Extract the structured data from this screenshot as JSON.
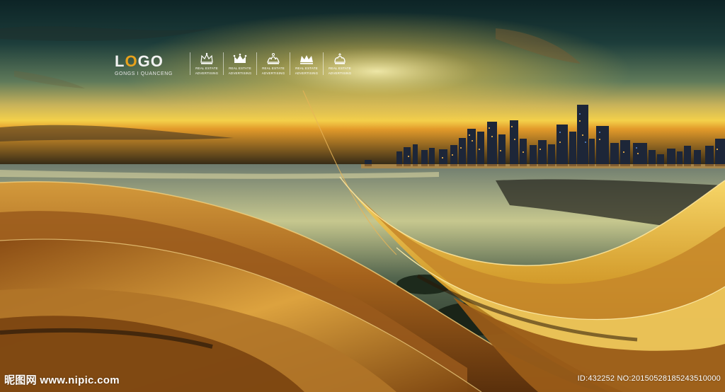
{
  "logo": {
    "title_prefix": "L",
    "title_o": "O",
    "title_suffix": "GO",
    "subtitle": "GONGS I QUANCENG"
  },
  "brands": [
    {
      "icon": "crown-icon",
      "line1": "REAL ESTATE",
      "line2": "ADVERTISING"
    },
    {
      "icon": "crown-icon",
      "line1": "REAL ESTATE",
      "line2": "ADVERTISING"
    },
    {
      "icon": "crown-icon",
      "line1": "REAL ESTATE",
      "line2": "ADVERTISING"
    },
    {
      "icon": "crown-icon",
      "line1": "REAL ESTATE",
      "line2": "ADVERTISING"
    },
    {
      "icon": "crown-icon",
      "line1": "REAL ESTATE",
      "line2": "ADVERTISING"
    }
  ],
  "watermark": {
    "site": "昵图网 www.nipic.com",
    "id_text": "ID:432252 NO:20150528185243510000"
  },
  "colors": {
    "sky_top": "#0e2a2a",
    "horizon_glow": "#f3c84a",
    "gold_ribbon": "#b9741f",
    "gold_highlight": "#f6d265",
    "logo_accent": "#e8a21c"
  }
}
